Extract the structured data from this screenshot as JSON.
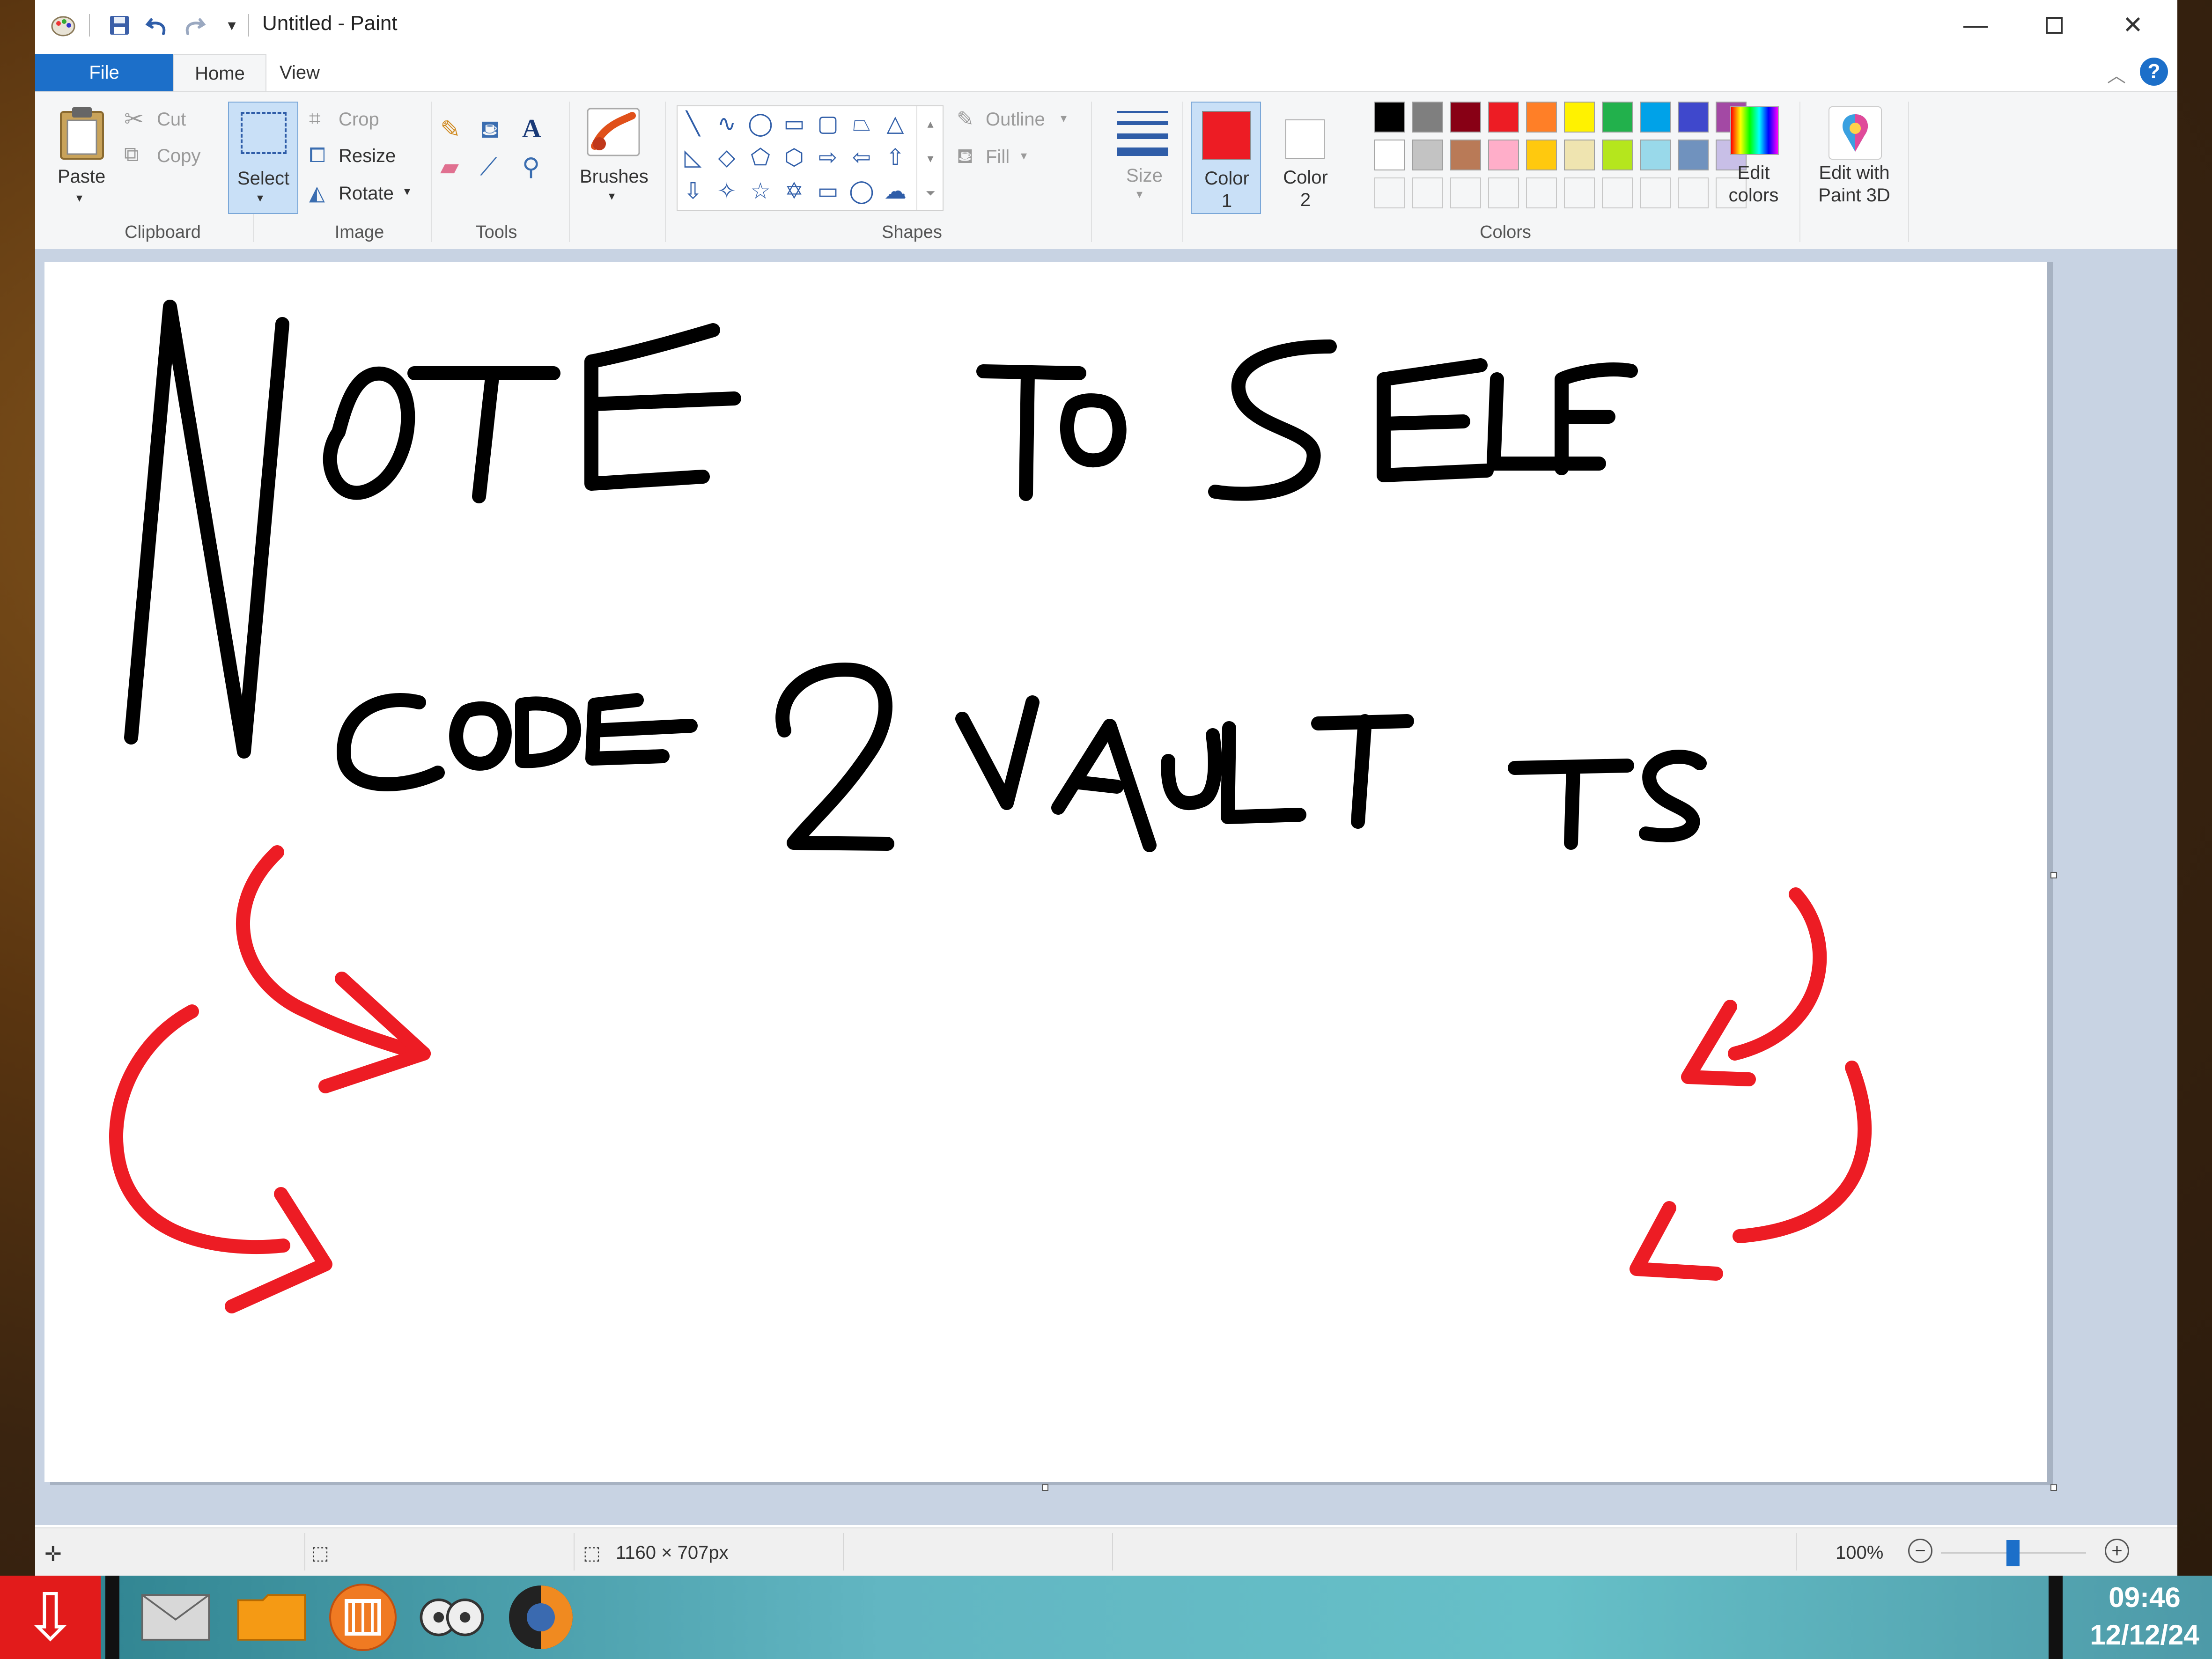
{
  "window": {
    "title": "Untitled - Paint"
  },
  "tabs": [
    {
      "label": "File"
    },
    {
      "label": "Home"
    },
    {
      "label": "View"
    }
  ],
  "ribbon": {
    "clipboard": {
      "paste": "Paste",
      "cut": "Cut",
      "copy": "Copy",
      "group": "Clipboard"
    },
    "image": {
      "select": "Select",
      "crop": "Crop",
      "resize": "Resize",
      "rotate": "Rotate",
      "group": "Image"
    },
    "tools": {
      "group": "Tools"
    },
    "brushes": {
      "label": "Brushes"
    },
    "shapes": {
      "outline": "Outline",
      "fill": "Fill",
      "group": "Shapes"
    },
    "size": {
      "label": "Size"
    },
    "colors": {
      "color1": "Color 1",
      "color2": "Color 2",
      "edit_colors": "Edit colors",
      "edit_paint3d": "Edit with Paint 3D",
      "group": "Colors",
      "color1_value": "#ed1c24",
      "color2_value": "#ffffff",
      "palette_row1": [
        "#000000",
        "#7f7f7f",
        "#880015",
        "#ed1c24",
        "#ff7f27",
        "#fff200",
        "#22b14c",
        "#00a2e8",
        "#3f48cc",
        "#a349a4"
      ],
      "palette_row2": [
        "#ffffff",
        "#c3c3c3",
        "#b97a57",
        "#ffaec9",
        "#ffc90e",
        "#efe4b0",
        "#b5e61d",
        "#99d9ea",
        "#7092be",
        "#c8bfe7"
      ]
    }
  },
  "canvas": {
    "ink_color": "#000000",
    "arrow_color": "#ed1c24"
  },
  "status": {
    "dimensions": "1160 × 707px",
    "zoom": "100%"
  },
  "taskbar": {
    "time": "09:46",
    "date": "12/12/24"
  }
}
